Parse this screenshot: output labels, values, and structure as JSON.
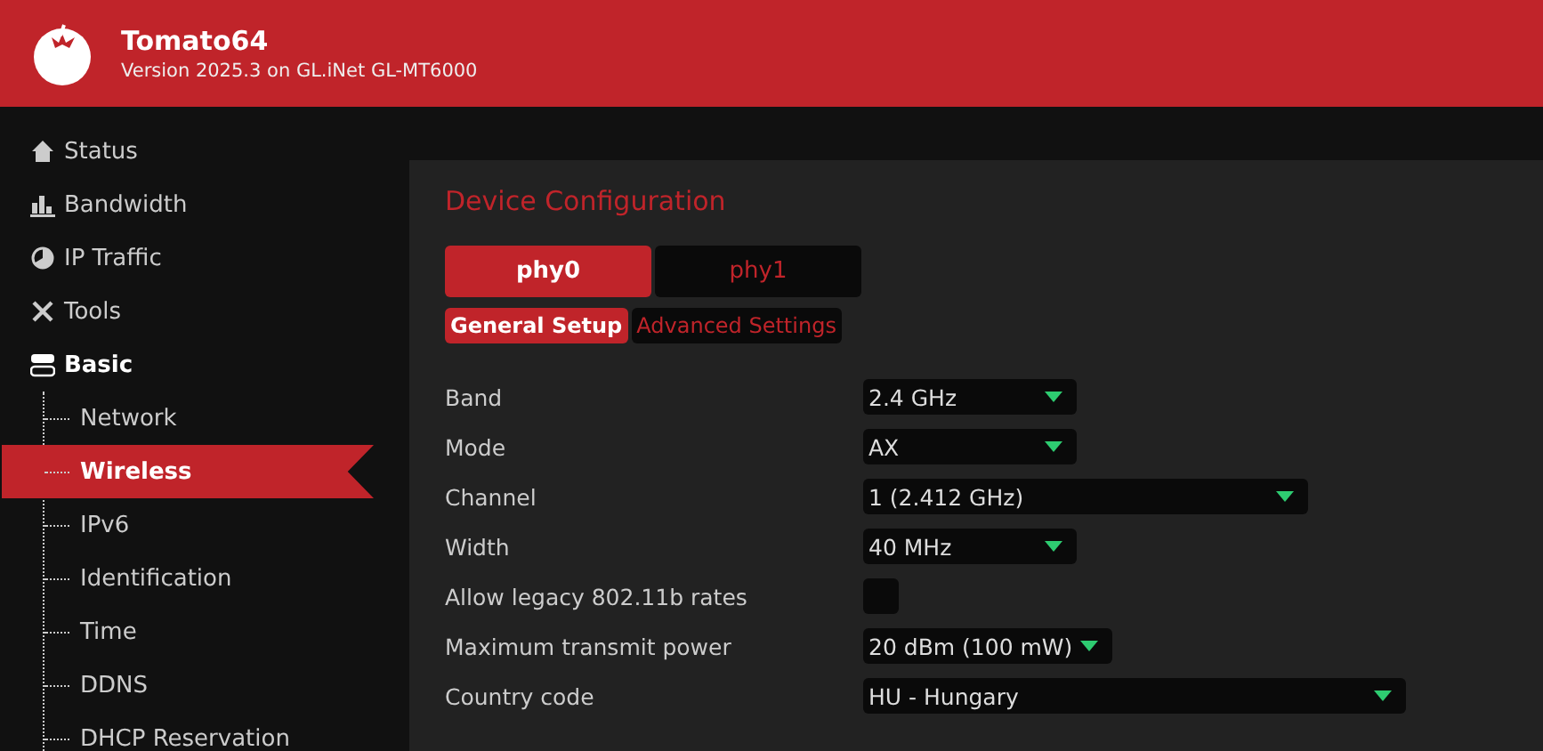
{
  "header": {
    "title": "Tomato64",
    "subtitle": "Version 2025.3 on GL.iNet GL-MT6000"
  },
  "sidebar": {
    "items": [
      {
        "label": "Status",
        "selected": false
      },
      {
        "label": "Bandwidth",
        "selected": false
      },
      {
        "label": "IP Traffic",
        "selected": false
      },
      {
        "label": "Tools",
        "selected": false
      },
      {
        "label": "Basic",
        "selected": false,
        "expanded": true,
        "children": [
          {
            "label": "Network",
            "selected": false
          },
          {
            "label": "Wireless",
            "selected": true
          },
          {
            "label": "IPv6",
            "selected": false
          },
          {
            "label": "Identification",
            "selected": false
          },
          {
            "label": "Time",
            "selected": false
          },
          {
            "label": "DDNS",
            "selected": false
          },
          {
            "label": "DHCP Reservation",
            "selected": false
          }
        ]
      }
    ]
  },
  "section": {
    "title": "Device Configuration",
    "tabs": [
      {
        "label": "phy0",
        "selected": true
      },
      {
        "label": "phy1",
        "selected": false
      }
    ],
    "subtabs": [
      {
        "label": "General Setup",
        "selected": true
      },
      {
        "label": "Advanced Settings",
        "selected": false
      }
    ],
    "fields": [
      {
        "label": "Band",
        "kind": "select",
        "value": "2.4 GHz"
      },
      {
        "label": "Mode",
        "kind": "select",
        "value": "AX"
      },
      {
        "label": "Channel",
        "kind": "select",
        "value": "1 (2.412 GHz)"
      },
      {
        "label": "Width",
        "kind": "select",
        "value": "40 MHz"
      },
      {
        "label": "Allow legacy 802.11b rates",
        "kind": "checkbox",
        "checked": false
      },
      {
        "label": "Maximum transmit power",
        "kind": "select",
        "value": "20 dBm (100 mW)"
      },
      {
        "label": "Country code",
        "kind": "select",
        "value": "HU - Hungary"
      }
    ]
  }
}
